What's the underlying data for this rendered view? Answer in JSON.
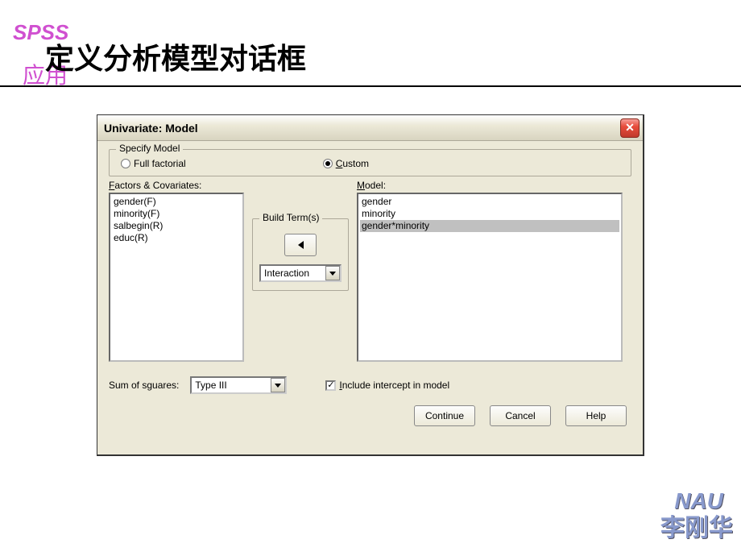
{
  "header": {
    "spss": "SPSS",
    "app": "应用",
    "title": "定义分析模型对话框"
  },
  "dialog": {
    "title": "Univariate: Model",
    "specify_model": {
      "legend": "Specify Model",
      "full_factorial": "Full factorial",
      "custom": "Custom",
      "selected": "custom"
    },
    "factors": {
      "label": "Factors & Covariates:",
      "items": [
        "gender(F)",
        "minority(F)",
        "salbegin(R)",
        "educ(R)"
      ]
    },
    "build_terms": {
      "legend": "Build Term(s)",
      "type": "Interaction"
    },
    "model": {
      "label": "Model:",
      "items": [
        "gender",
        "minority",
        "gender*minority"
      ],
      "selected_index": 2
    },
    "sum_squares": {
      "label": "Sum of sguares:",
      "value": "Type III"
    },
    "include_intercept": {
      "label": "Include intercept in model",
      "checked": true
    },
    "buttons": {
      "continue": "Continue",
      "cancel": "Cancel",
      "help": "Help"
    }
  },
  "footer": {
    "org": "NAU",
    "author": "李刚华"
  }
}
